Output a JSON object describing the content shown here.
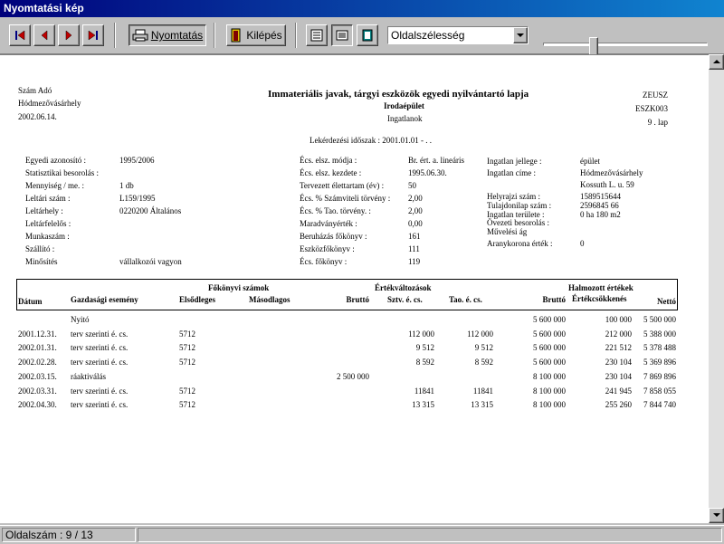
{
  "window": {
    "title": "Nyomtatási kép"
  },
  "toolbar": {
    "print_label": "Nyomtatás",
    "exit_label": "Kilépés",
    "zoom_value": "Oldalszélesség"
  },
  "status": {
    "page": "Oldalszám : 9 / 13"
  },
  "report": {
    "left_header": [
      "Szám Adó",
      "Hódmezővásárhely",
      "2002.06.14."
    ],
    "title": "Immateriális javak, tárgyi eszközök egyedi nyilvántartó lapja",
    "subtitle": "Irodaépület",
    "subtitle2": "Ingatlanok",
    "right_header": [
      "ZEUSZ",
      "ESZK003",
      "9 . lap"
    ],
    "query_time": "Lekérdezési időszak : 2001.01.01 -    . .",
    "col1": [
      {
        "label": "Egyedi azonosító :",
        "value": "1995/2006"
      },
      {
        "label": "Statisztikai besorolás :",
        "value": ""
      },
      {
        "label": "Mennyiség / me. :",
        "value": "1 db"
      },
      {
        "label": "Leltári szám :",
        "value": "L159/1995"
      },
      {
        "label": "Leltárhely :",
        "value": "0220200 Általános"
      },
      {
        "label": "Leltárfelelős :",
        "value": ""
      },
      {
        "label": "Munkaszám :",
        "value": ""
      },
      {
        "label": "Szállító :",
        "value": ""
      },
      {
        "label": "Minősítés",
        "value": "vállalkozói vagyon"
      }
    ],
    "col2": [
      {
        "label": "Écs. elsz. módja :",
        "value": "Br. ért. a. lineáris"
      },
      {
        "label": "Écs. elsz. kezdete :",
        "value": "1995.06.30."
      },
      {
        "label": "Tervezett élettartam (év) :",
        "value": "50"
      },
      {
        "label": "Écs. % Számviteli törvény :",
        "value": "2,00"
      },
      {
        "label": "Écs. % Tao. törvény. :",
        "value": "2,00"
      },
      {
        "label": "Maradványérték :",
        "value": "0,00"
      },
      {
        "label": "Beruházás főkönyv :",
        "value": "161"
      },
      {
        "label": "Eszközfőkönyv :",
        "value": "111"
      },
      {
        "label": "Écs. főkönyv :",
        "value": "119"
      }
    ],
    "col3": [
      {
        "label": "Ingatlan jellege :",
        "value": "épület"
      },
      {
        "label": "Ingatlan címe :",
        "value": "Hódmezővásárhely"
      },
      {
        "label": "",
        "value": "Kossuth L. u. 59"
      },
      {
        "label": "Helyrajzi szám :",
        "value": "1589515644"
      },
      {
        "label": "Tulajdonilap szám :",
        "value": "2596845 66"
      },
      {
        "label": "Ingatlan területe :",
        "value": "0 ha 180 m2"
      },
      {
        "label": "Övezeti besorolás :",
        "value": ""
      },
      {
        "label": "Művelési ág",
        "value": ""
      },
      {
        "label": "Aranykorona érték :",
        "value": "0"
      }
    ],
    "table": {
      "group_headers": {
        "fokonyv": "Főkönyvi számok",
        "ertekvaltozasok": "Értékváltozások",
        "halmozott": "Halmozott értékek"
      },
      "headers": [
        "Dátum",
        "Gazdasági esemény",
        "Elsődleges",
        "Másodlagos",
        "Bruttó",
        "Sztv. é. cs.",
        "Tao. é. cs.",
        "Bruttó",
        "Értékcsökkenés",
        "Nettó"
      ],
      "rows": [
        [
          "",
          "Nyitó",
          "",
          "",
          "",
          "",
          "",
          "5 600 000",
          "100 000",
          "5 500 000"
        ],
        [
          "2001.12.31.",
          "terv szerinti é. cs.",
          "5712",
          "",
          "",
          "112 000",
          "112 000",
          "5 600 000",
          "212 000",
          "5 388 000"
        ],
        [
          "2002.01.31.",
          "terv szerinti é. cs.",
          "5712",
          "",
          "",
          "9 512",
          "9 512",
          "5 600 000",
          "221 512",
          "5 378 488"
        ],
        [
          "2002.02.28.",
          "terv szerinti é. cs.",
          "5712",
          "",
          "",
          "8 592",
          "8 592",
          "5 600 000",
          "230 104",
          "5 369 896"
        ],
        [
          "2002.03.15.",
          "ráaktiválás",
          "",
          "",
          "2 500 000",
          "",
          "",
          "8 100 000",
          "230 104",
          "7 869 896"
        ],
        [
          "2002.03.31.",
          "terv szerinti é. cs.",
          "5712",
          "",
          "",
          "11841",
          "11841",
          "8 100 000",
          "241 945",
          "7 858 055"
        ],
        [
          "2002.04.30.",
          "terv szerinti é. cs.",
          "5712",
          "",
          "",
          "13 315",
          "13 315",
          "8 100 000",
          "255 260",
          "7 844 740"
        ]
      ]
    }
  }
}
